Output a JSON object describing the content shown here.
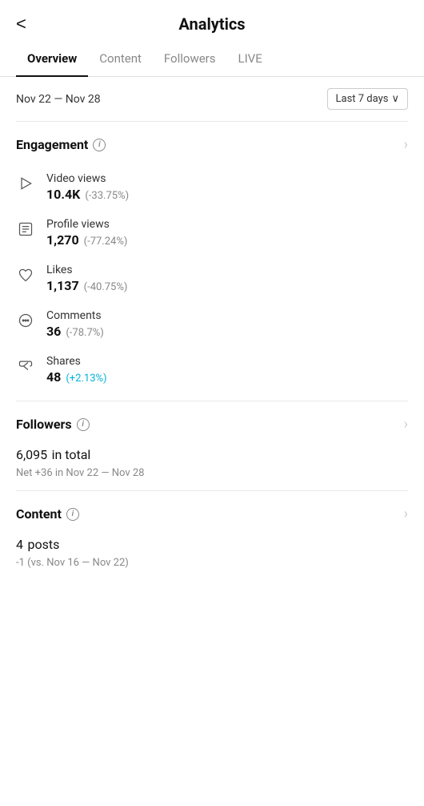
{
  "header": {
    "back_label": "<",
    "title": "Analytics"
  },
  "tabs": [
    {
      "label": "Overview",
      "active": true
    },
    {
      "label": "Content",
      "active": false
    },
    {
      "label": "Followers",
      "active": false
    },
    {
      "label": "LIVE",
      "active": false
    }
  ],
  "date_range": {
    "label": "Nov 22 — Nov 28",
    "picker_label": "Last 7 days",
    "picker_arrow": "∨"
  },
  "engagement": {
    "section_title": "Engagement",
    "info_char": "i",
    "metrics": [
      {
        "name": "Video views",
        "value": "10.4K",
        "change": "(-33.75%)",
        "positive": false,
        "icon": "play"
      },
      {
        "name": "Profile views",
        "value": "1,270",
        "change": "(-77.24%)",
        "positive": false,
        "icon": "profile"
      },
      {
        "name": "Likes",
        "value": "1,137",
        "change": "(-40.75%)",
        "positive": false,
        "icon": "heart"
      },
      {
        "name": "Comments",
        "value": "36",
        "change": "(-78.7%)",
        "positive": false,
        "icon": "comment"
      },
      {
        "name": "Shares",
        "value": "48",
        "change": "(+2.13%)",
        "positive": true,
        "icon": "share"
      }
    ]
  },
  "followers": {
    "section_title": "Followers",
    "info_char": "i",
    "total_value": "6,095",
    "total_label": "in total",
    "net_label": "Net +36 in Nov 22 — Nov 28"
  },
  "content": {
    "section_title": "Content",
    "info_char": "i",
    "posts_value": "4",
    "posts_label": "posts",
    "compare_label": "-1 (vs. Nov 16 — Nov 22)"
  }
}
